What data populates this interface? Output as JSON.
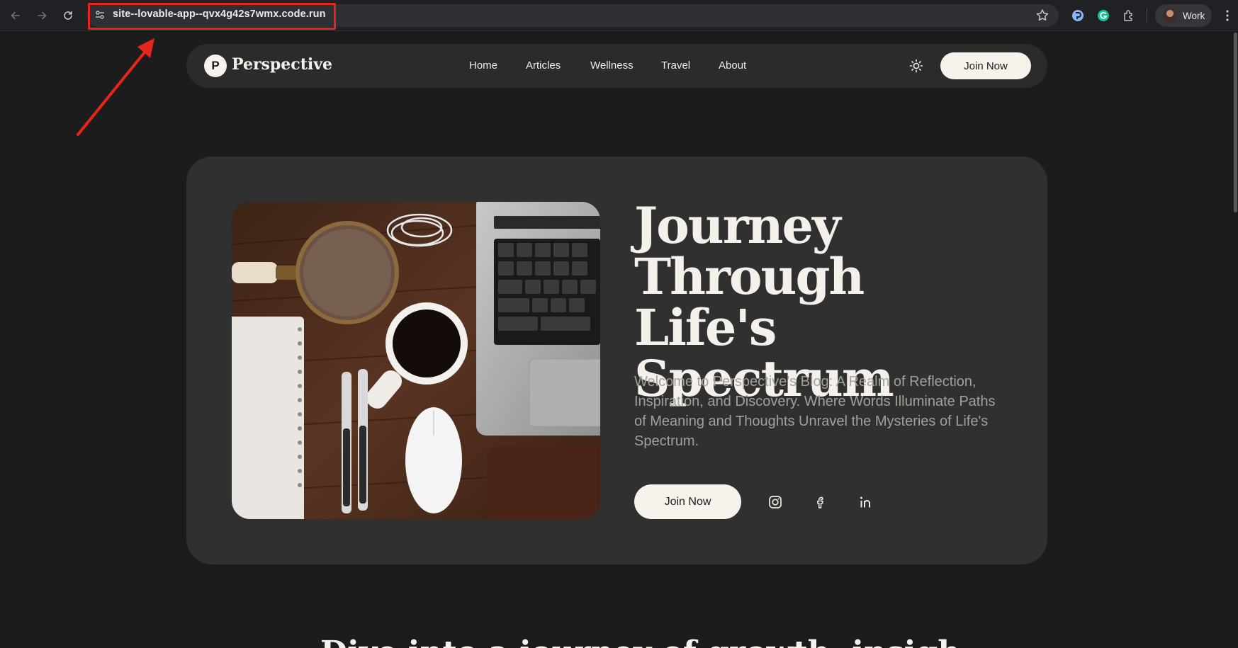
{
  "browser": {
    "url": "site--lovable-app--qvx4g42s7wmx.code.run",
    "profile_label": "Work"
  },
  "site": {
    "logo_letter": "P",
    "brand_name": "Perspective",
    "nav": [
      {
        "label": "Home"
      },
      {
        "label": "Articles"
      },
      {
        "label": "Wellness"
      },
      {
        "label": "Travel"
      },
      {
        "label": "About"
      }
    ],
    "nav_cta_label": "Join Now"
  },
  "hero": {
    "title_lines": [
      "Journey",
      "Through Life's",
      "Spectrum"
    ],
    "description": "Welcome to Perspective's Blog: A Realm of Reflection, Inspiration, and Discovery. Where Words Illuminate Paths of Meaning and Thoughts Unravel the Mysteries of Life's Spectrum.",
    "cta_label": "Join Now",
    "socials": [
      "instagram-icon",
      "facebook-icon",
      "linkedin-icon"
    ]
  },
  "next_section": {
    "heading_partial": "Dive into a journey of growth, insight and finding"
  },
  "colors": {
    "page_bg": "#1c1c1c",
    "card_bg": "#303030",
    "nav_bg": "#2b2b2b",
    "cream": "#f7f3ec",
    "annotation_red": "#e8251a"
  }
}
